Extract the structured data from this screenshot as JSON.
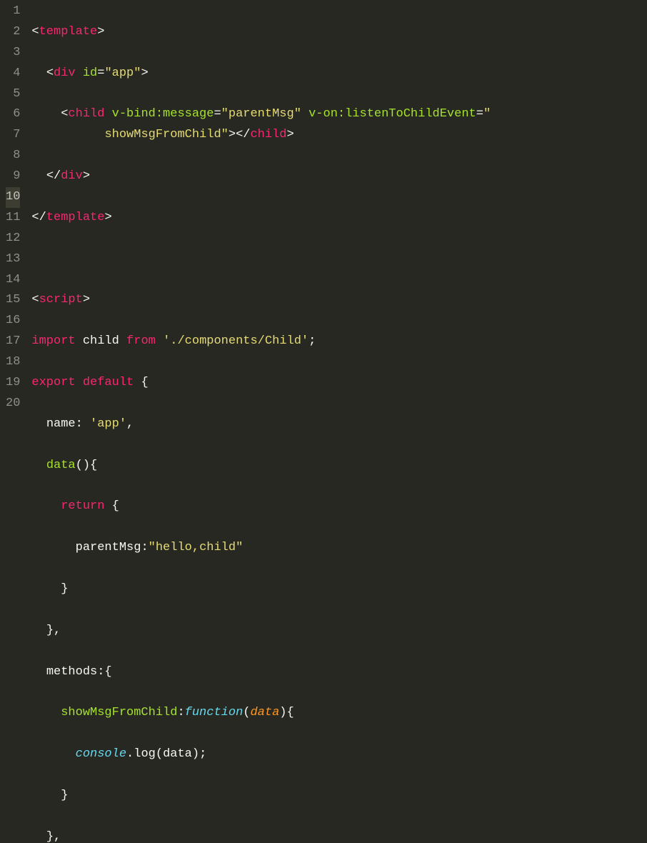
{
  "lineNumbers": [
    "1",
    "2",
    "3",
    "4",
    "5",
    "6",
    "7",
    "8",
    "9",
    "10",
    "11",
    "12",
    "13",
    "14",
    "15",
    "16",
    "17",
    "18",
    "19",
    "20"
  ],
  "activeLine": "10",
  "code": {
    "l1_template_open": "template",
    "l2_div_tag": "div",
    "l2_div_attr_id": "id",
    "l2_div_attr_id_val": "\"app\"",
    "l3_child_tag": "child",
    "l3_vbind_attr": "v-bind:message",
    "l3_vbind_val": "\"parentMsg\"",
    "l3_von_attr": "v-on:listenToChildEvent",
    "l3b_von_val": "\"\n          showMsgFromChild\"",
    "l3_von_val_wrap": "\"",
    "l3b_indent": "          ",
    "l3b_von_val_text": "showMsgFromChild\"",
    "l3b_child_close": "child",
    "l4_div_close": "div",
    "l5_template_close": "template",
    "l7_script_tag": "script",
    "l8_import": "import",
    "l8_child_name": "child",
    "l8_from": "from",
    "l8_path": "'./components/Child'",
    "l9_export": "export",
    "l9_default": "default",
    "l10_name_key": "name",
    "l10_name_val": "'app'",
    "l11_data_fn": "data",
    "l12_return": "return",
    "l13_parentMsg_key": "parentMsg",
    "l13_parentMsg_val": "\"hello,child\"",
    "l16_methods_key": "methods",
    "l17_showMsg_key": "showMsgFromChild",
    "l17_function": "function",
    "l17_param": "data",
    "l18_console": "console",
    "l18_log": "log",
    "l18_arg": "data"
  }
}
